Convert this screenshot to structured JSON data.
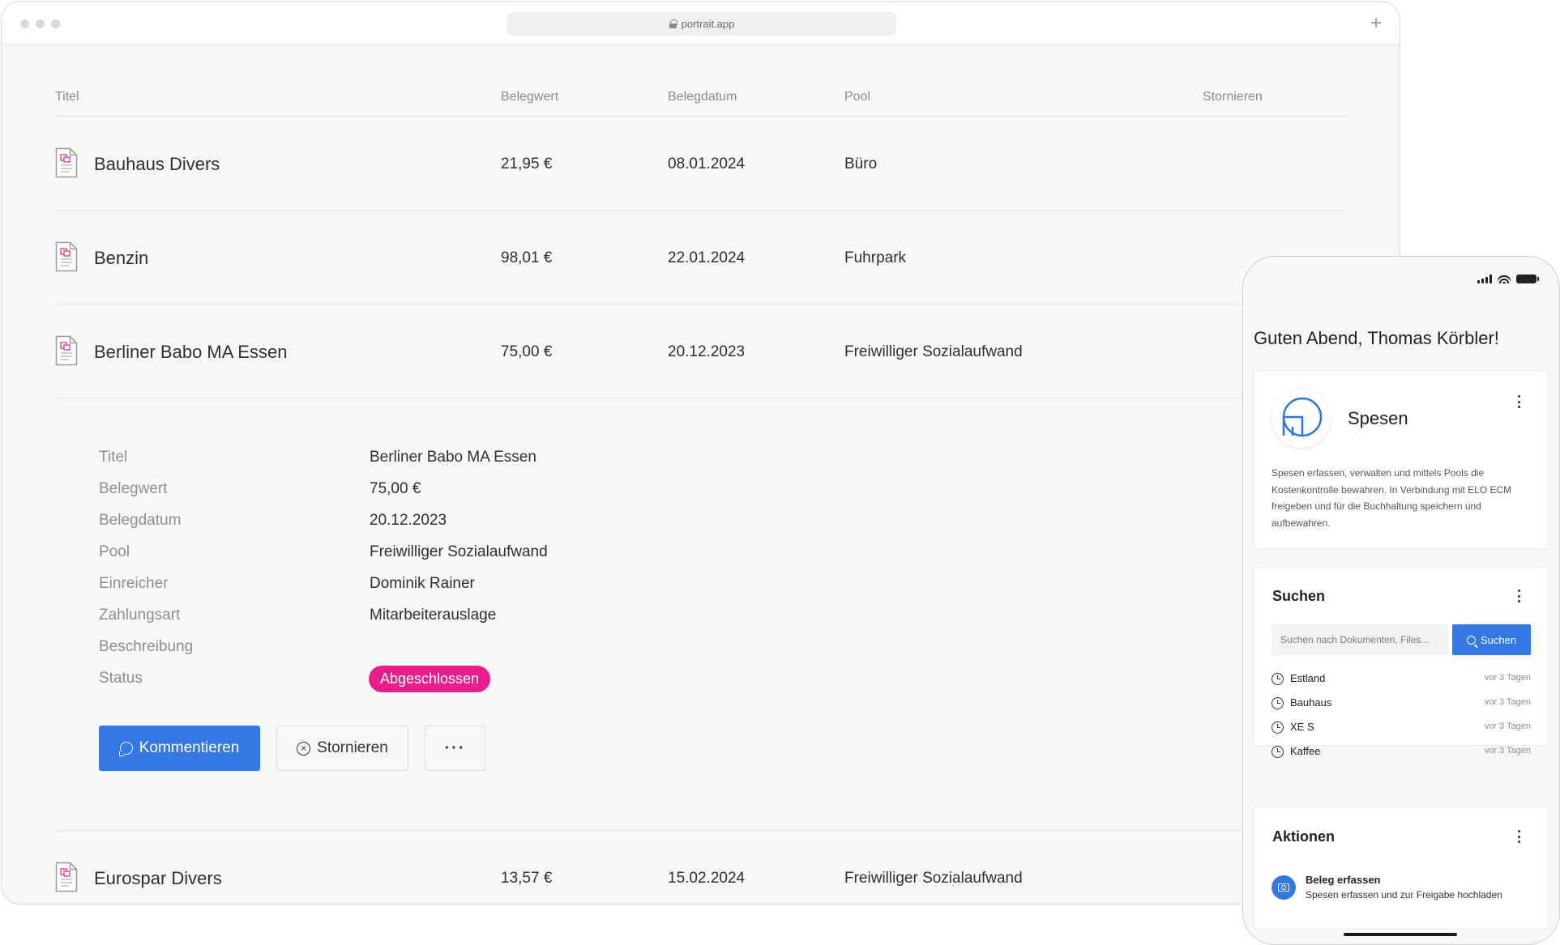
{
  "browser": {
    "url": "portrait.app",
    "new_tab_label": "+"
  },
  "table": {
    "headers": {
      "title": "Titel",
      "value": "Belegwert",
      "date": "Belegdatum",
      "pool": "Pool",
      "cancel": "Stornieren"
    },
    "rows": [
      {
        "title": "Bauhaus Divers",
        "value": "21,95 €",
        "date": "08.01.2024",
        "pool": "Büro"
      },
      {
        "title": "Benzin",
        "value": "98,01 €",
        "date": "22.01.2024",
        "pool": "Fuhrpark"
      },
      {
        "title": "Berliner Babo MA Essen",
        "value": "75,00 €",
        "date": "20.12.2023",
        "pool": "Freiwilliger Sozialaufwand"
      },
      {
        "title": "Eurospar Divers",
        "value": "13,57 €",
        "date": "15.02.2024",
        "pool": "Freiwilliger Sozialaufwand"
      }
    ]
  },
  "detail": {
    "fields": [
      {
        "label": "Titel",
        "value": "Berliner Babo MA Essen"
      },
      {
        "label": "Belegwert",
        "value": "75,00 €"
      },
      {
        "label": "Belegdatum",
        "value": "20.12.2023"
      },
      {
        "label": "Pool",
        "value": "Freiwilliger Sozialaufwand"
      },
      {
        "label": "Einreicher",
        "value": "Dominik Rainer"
      },
      {
        "label": "Zahlungsart",
        "value": "Mitarbeiterauslage"
      },
      {
        "label": "Beschreibung",
        "value": ""
      },
      {
        "label": "Status",
        "value": ""
      }
    ],
    "status_badge": "Abgeschlossen",
    "status_color": "#e91e8c",
    "buttons": {
      "comment": "Kommentieren",
      "cancel": "Stornieren",
      "more": "···"
    }
  },
  "phone": {
    "greeting": "Guten Abend, Thomas Körbler!",
    "spesen_card": {
      "name": "Spesen",
      "description": "Spesen erfassen, verwalten und mittels Pools die Kostenkontrolle bewahren. In Verbindung mit ELO ECM freigeben und für die Buchhaltung speichern und aufbewahren."
    },
    "search_card": {
      "title": "Suchen",
      "placeholder": "Suchen nach Dokumenten, Files...",
      "button": "Suchen",
      "recent": [
        {
          "label": "Estland",
          "time": "vor 3 Tagen"
        },
        {
          "label": "Bauhaus",
          "time": "vor 3 Tagen"
        },
        {
          "label": "XE S",
          "time": "vor 3 Tagen"
        },
        {
          "label": "Kaffee",
          "time": "vor 3 Tagen"
        }
      ]
    },
    "actions_card": {
      "title": "Aktionen",
      "item_title": "Beleg erfassen",
      "item_subtitle": "Spesen erfassen und zur Freigabe hochladen"
    }
  },
  "colors": {
    "accent": "#3478e4",
    "badge": "#e91e8c",
    "doc_icon": "#e8408a"
  }
}
